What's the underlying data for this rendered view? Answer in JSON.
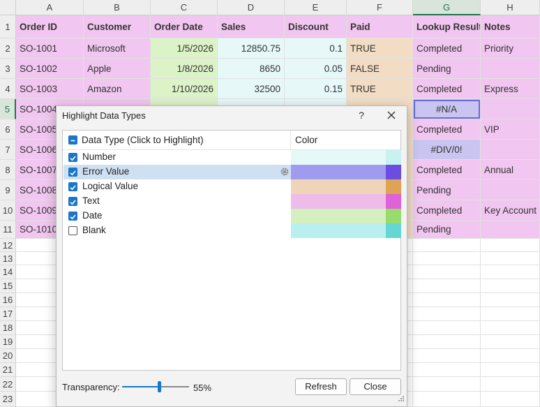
{
  "sheet": {
    "columns": [
      "A",
      "B",
      "C",
      "D",
      "E",
      "F",
      "G",
      "H"
    ],
    "selected_column": "G",
    "selected_row": 5,
    "row_numbers": [
      1,
      2,
      3,
      4,
      5,
      6,
      7,
      8,
      9,
      10,
      11,
      12,
      13,
      14,
      15,
      16,
      17,
      18,
      19,
      20,
      21,
      22,
      23
    ],
    "headers": [
      "Order ID",
      "Customer",
      "Order Date",
      "Sales",
      "Discount",
      "Paid",
      "Lookup Result",
      "Notes"
    ],
    "rows": [
      [
        "SO-1001",
        "Microsoft",
        "1/5/2026",
        "12850.75",
        "0.1",
        "TRUE",
        "Completed",
        "Priority"
      ],
      [
        "SO-1002",
        "Apple",
        "1/8/2026",
        "8650",
        "0.05",
        "FALSE",
        "Pending",
        ""
      ],
      [
        "SO-1003",
        "Amazon",
        "1/10/2026",
        "32500",
        "0.15",
        "TRUE",
        "Completed",
        "Express"
      ],
      [
        "SO-1004",
        "",
        "",
        "",
        "",
        "",
        "#N/A",
        ""
      ],
      [
        "SO-1005",
        "",
        "",
        "",
        "",
        "",
        "Completed",
        "VIP"
      ],
      [
        "SO-1006",
        "",
        "",
        "",
        "",
        "",
        "#DIV/0!",
        ""
      ],
      [
        "SO-1007",
        "",
        "",
        "",
        "",
        "",
        "Completed",
        "Annual"
      ],
      [
        "SO-1008",
        "",
        "",
        "",
        "",
        "",
        "Pending",
        ""
      ],
      [
        "SO-1009",
        "",
        "",
        "",
        "",
        "",
        "Completed",
        "Key Account"
      ],
      [
        "SO-1010",
        "",
        "",
        "",
        "",
        "",
        "Pending",
        ""
      ]
    ],
    "colors": {
      "text": "#f1c6f0",
      "date": "#dcf3c8",
      "number": "#e6f8f8",
      "logical": "#f3dcc4",
      "error": "#c9c5f0"
    }
  },
  "dialog": {
    "title": "Highlight Data Types",
    "help_label": "?",
    "list_header": {
      "type_label": "Data Type (Click to Highlight)",
      "color_label": "Color"
    },
    "items": [
      {
        "label": "Number",
        "checked": true,
        "color": "#e6f8f8",
        "end_color": "#c8f2f2"
      },
      {
        "label": "Error Value",
        "checked": true,
        "color": "#9f9bee",
        "end_color": "#6b4ee0",
        "highlighted": true
      },
      {
        "label": "Logical Value",
        "checked": true,
        "color": "#f0d4b8",
        "end_color": "#dda456"
      },
      {
        "label": "Text",
        "checked": true,
        "color": "#efbcea",
        "end_color": "#de62d8"
      },
      {
        "label": "Date",
        "checked": true,
        "color": "#d4efc0",
        "end_color": "#98dc6c"
      },
      {
        "label": "Blank",
        "checked": false,
        "color": "#b9efee",
        "end_color": "#66d6d4"
      }
    ],
    "transparency_label": "Transparency:",
    "transparency_value": 0.55,
    "transparency_text": "55%",
    "refresh_label": "Refresh",
    "close_label": "Close"
  }
}
